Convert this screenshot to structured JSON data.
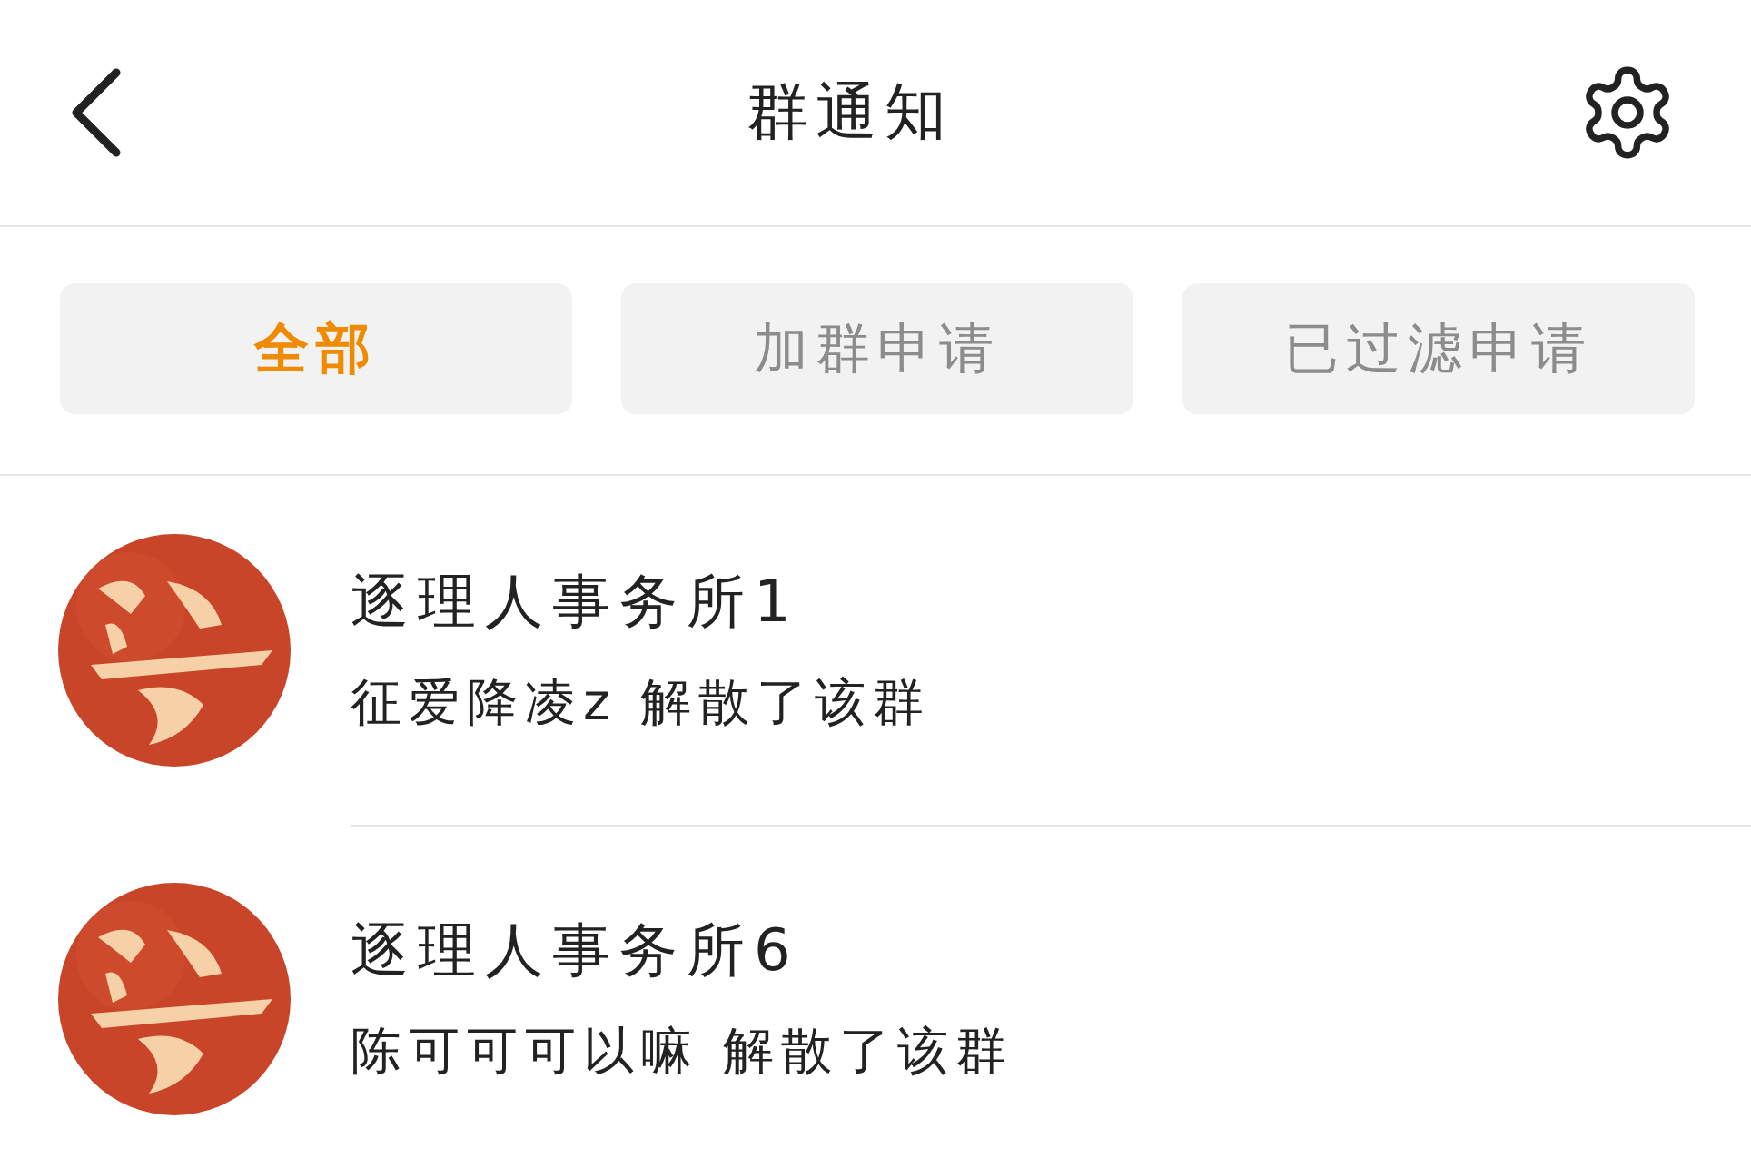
{
  "header": {
    "title": "群通知"
  },
  "tabs": [
    {
      "label": "全部",
      "selected": true
    },
    {
      "label": "加群申请",
      "selected": false
    },
    {
      "label": "已过滤申请",
      "selected": false
    }
  ],
  "notices": [
    {
      "group": "逐理人事务所1",
      "message": "征爱降凌z 解散了该群"
    },
    {
      "group": "逐理人事务所6",
      "message": "陈可可可以嘛 解散了该群"
    }
  ]
}
